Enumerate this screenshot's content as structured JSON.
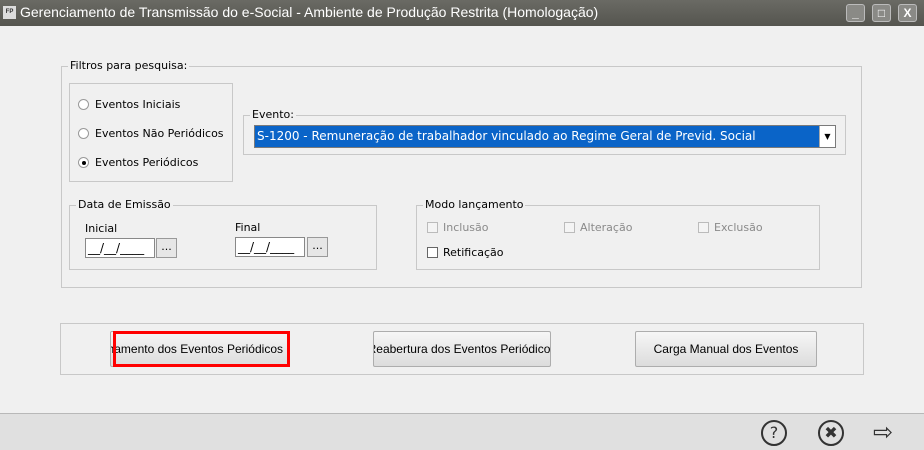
{
  "window": {
    "title": "Gerenciamento de Transmissão do e-Social - Ambiente de Produção Restrita (Homologação)",
    "app_icon": "FP",
    "minimize": "_",
    "maximize": "□",
    "close": "X"
  },
  "filters": {
    "legend": "Filtros para pesquisa:",
    "radios": [
      {
        "label": "Eventos Iniciais",
        "checked": false
      },
      {
        "label": "Eventos Não Periódicos",
        "checked": false
      },
      {
        "label": "Eventos Periódicos",
        "checked": true
      }
    ],
    "evento": {
      "legend": "Evento:",
      "selected": "S-1200 - Remuneração de trabalhador vinculado ao Regime Geral de Previd. Social"
    },
    "data_emissao": {
      "legend": "Data de Emissão",
      "inicial_label": "Inicial",
      "inicial_value": "__/__/____",
      "final_label": "Final",
      "final_value": "__/__/____",
      "picker": "..."
    },
    "modo": {
      "legend": "Modo lançamento",
      "options": [
        {
          "label": "Inclusão",
          "enabled": false
        },
        {
          "label": "Alteração",
          "enabled": false
        },
        {
          "label": "Exclusão",
          "enabled": false
        },
        {
          "label": "Retificação",
          "enabled": true
        }
      ]
    }
  },
  "actions": {
    "fechamento": "Fechamento dos Eventos Periódicos",
    "reabertura": "Reabertura dos Eventos Periódicos",
    "carga": "Carga Manual dos Eventos"
  },
  "footer": {
    "help": "?",
    "cancel": "✖",
    "next": "⇨"
  },
  "colors": {
    "highlight": "#ff0000",
    "selection": "#0a64c8"
  }
}
